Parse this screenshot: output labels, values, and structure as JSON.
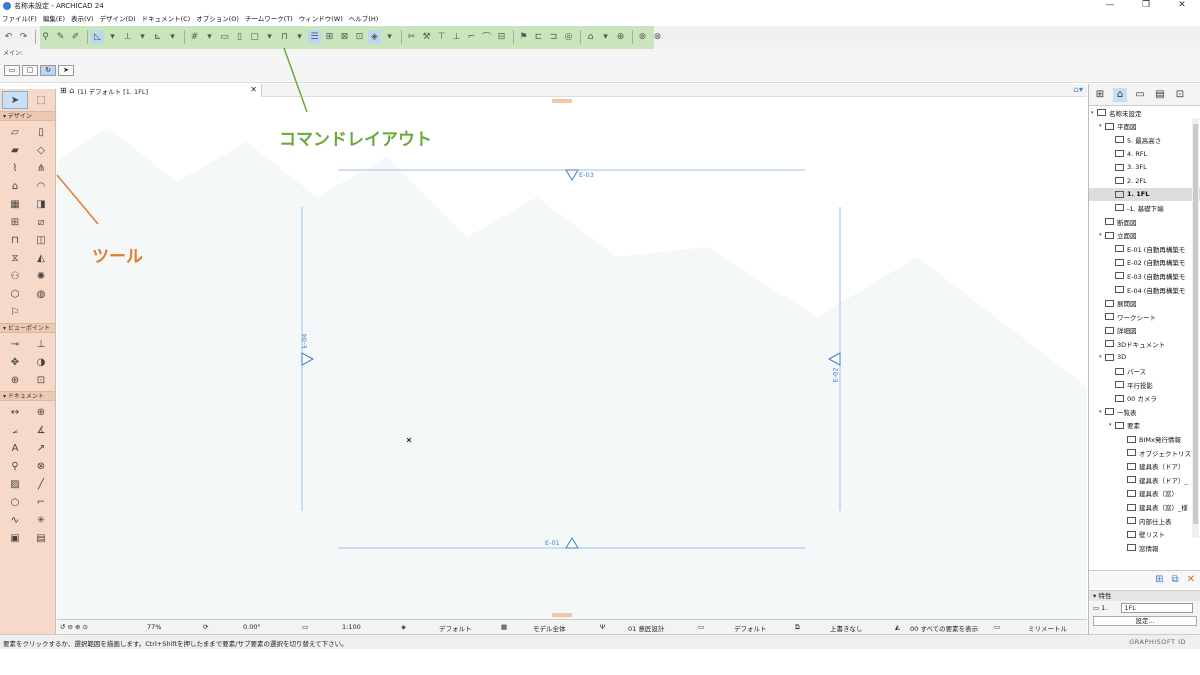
{
  "window": {
    "title": "名称未設定 - ARCHICAD 24",
    "controls": [
      "—",
      "❐",
      "✕"
    ]
  },
  "menu": [
    "ファイル(F)",
    "編集(E)",
    "表示(V)",
    "デザイン(D)",
    "ドキュメント(C)",
    "オプション(O)",
    "チームワーク(T)",
    "ウィンドウ(W)",
    "ヘルプ(H)"
  ],
  "mainbar": {
    "label": "メイン:"
  },
  "toolbox": {
    "sections": [
      {
        "name": "デザイン"
      },
      {
        "name": "ビューポイント"
      },
      {
        "name": "ドキュメント"
      }
    ]
  },
  "tab": {
    "label": "(1) デフォルト [1. 1FL]",
    "close": "✕"
  },
  "elevation_markers": {
    "top": "E-03",
    "bottom": "E-01",
    "left": "E-04",
    "right": "E-02"
  },
  "annotations": {
    "command_layout": "コマンドレイアウト",
    "tool": "ツール"
  },
  "bottombar": {
    "zoom": "77%",
    "angle": "0.00°",
    "scale": "1:100",
    "layer": "デフォルト",
    "model": "モデル全体",
    "pen": "01 意匠設計",
    "dim": "デフォルト",
    "override": "上書きなし",
    "reno": "00 すべての要素を表示",
    "units": "ミリメートル"
  },
  "status": {
    "message": "要素をクリックするか、選択範囲を描画します。Ctrl+Shiftを押したままで要素/サブ要素の選択を切り替えて下さい。",
    "logo": "GRAPHISOFT ID"
  },
  "navigator": {
    "tree": [
      {
        "label": "名称未設定",
        "level": 0,
        "selected": false
      },
      {
        "label": "平面図",
        "level": 1,
        "selected": false
      },
      {
        "label": "5. 最高高さ",
        "level": 2,
        "selected": false
      },
      {
        "label": "4. RFL",
        "level": 2,
        "selected": false
      },
      {
        "label": "3. 3FL",
        "level": 2,
        "selected": false
      },
      {
        "label": "2. 2FL",
        "level": 2,
        "selected": false
      },
      {
        "label": "1. 1FL",
        "level": 2,
        "selected": true
      },
      {
        "label": "-1. 基礎下端",
        "level": 2,
        "selected": false
      },
      {
        "label": "断面図",
        "level": 1,
        "selected": false
      },
      {
        "label": "立面図",
        "level": 1,
        "selected": false
      },
      {
        "label": "E-01 (自動再構築モ",
        "level": 2,
        "selected": false
      },
      {
        "label": "E-02 (自動再構築モ",
        "level": 2,
        "selected": false
      },
      {
        "label": "E-03 (自動再構築モ",
        "level": 2,
        "selected": false
      },
      {
        "label": "E-04 (自動再構築モ",
        "level": 2,
        "selected": false
      },
      {
        "label": "展開図",
        "level": 1,
        "selected": false
      },
      {
        "label": "ワークシート",
        "level": 1,
        "selected": false
      },
      {
        "label": "詳細図",
        "level": 1,
        "selected": false
      },
      {
        "label": "3Dドキュメント",
        "level": 1,
        "selected": false
      },
      {
        "label": "3D",
        "level": 1,
        "selected": false
      },
      {
        "label": "パース",
        "level": 2,
        "selected": false
      },
      {
        "label": "平行投影",
        "level": 2,
        "selected": false
      },
      {
        "label": "00 カメラ",
        "level": 2,
        "selected": false
      },
      {
        "label": "一覧表",
        "level": 1,
        "selected": false
      },
      {
        "label": "要素",
        "level": 2,
        "selected": false
      },
      {
        "label": "BIMx発行情報",
        "level": 3,
        "selected": false
      },
      {
        "label": "オブジェクトリスト",
        "level": 3,
        "selected": false
      },
      {
        "label": "建具表（ドア）",
        "level": 3,
        "selected": false
      },
      {
        "label": "建具表（ドア）_",
        "level": 3,
        "selected": false
      },
      {
        "label": "建具表（窓）",
        "level": 3,
        "selected": false
      },
      {
        "label": "建具表（窓）_様",
        "level": 3,
        "selected": false
      },
      {
        "label": "内部仕上表",
        "level": 3,
        "selected": false
      },
      {
        "label": "壁リスト",
        "level": 3,
        "selected": false
      },
      {
        "label": "窓情報",
        "level": 3,
        "selected": false
      }
    ],
    "props": {
      "header": "特性",
      "id": "1.",
      "value": "1FL",
      "button": "設定..."
    }
  },
  "colors": {
    "command_green": "#6aaa3a",
    "tool_orange": "#e8782a",
    "toolbox_bg": "#f6d9c9",
    "marker_blue": "#3d7ccf"
  }
}
